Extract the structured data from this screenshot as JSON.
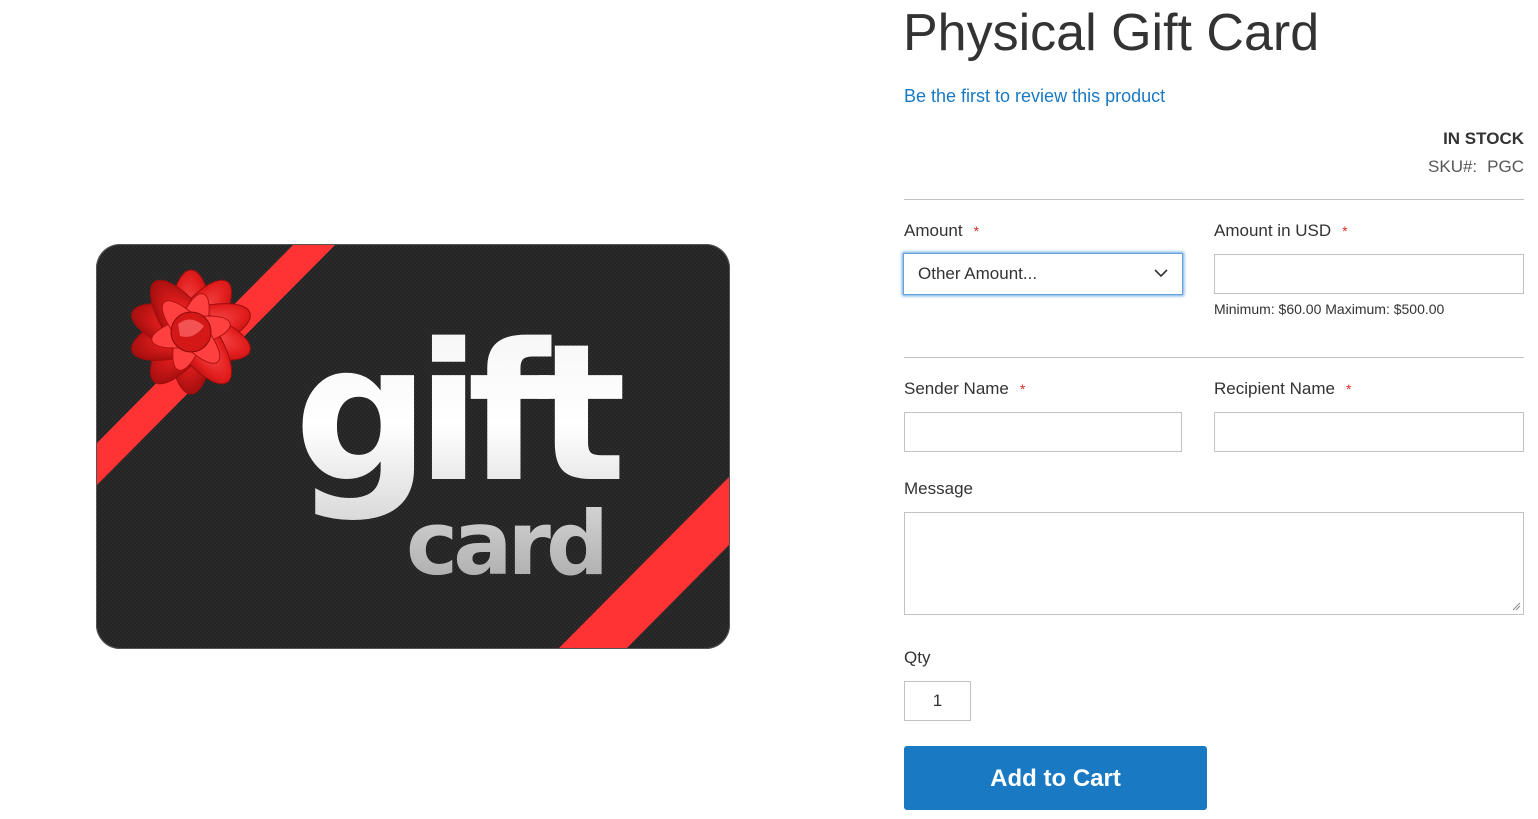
{
  "product": {
    "title": "Physical Gift Card",
    "review_link": "Be the first to review this product",
    "stock_status": "IN STOCK",
    "sku_label": "SKU#:",
    "sku_value": "PGC"
  },
  "image": {
    "alt": "gift card",
    "text_gift": "gift",
    "text_card": "card",
    "card_color": "#2a2a2a",
    "ribbon_color": "#ff3333"
  },
  "form": {
    "amount_label": "Amount",
    "amount_selected": "Other Amount...",
    "amount_usd_label": "Amount in USD",
    "amount_usd_value": "",
    "amount_note": "Minimum: $60.00 Maximum: $500.00",
    "sender_label": "Sender Name",
    "sender_value": "",
    "recipient_label": "Recipient Name",
    "recipient_value": "",
    "message_label": "Message",
    "message_value": "",
    "qty_label": "Qty",
    "qty_value": "1",
    "required_marker": "*"
  },
  "actions": {
    "add_to_cart": "Add to Cart"
  },
  "colors": {
    "link": "#1979c3",
    "button": "#1979c3",
    "required": "#e02b27"
  }
}
